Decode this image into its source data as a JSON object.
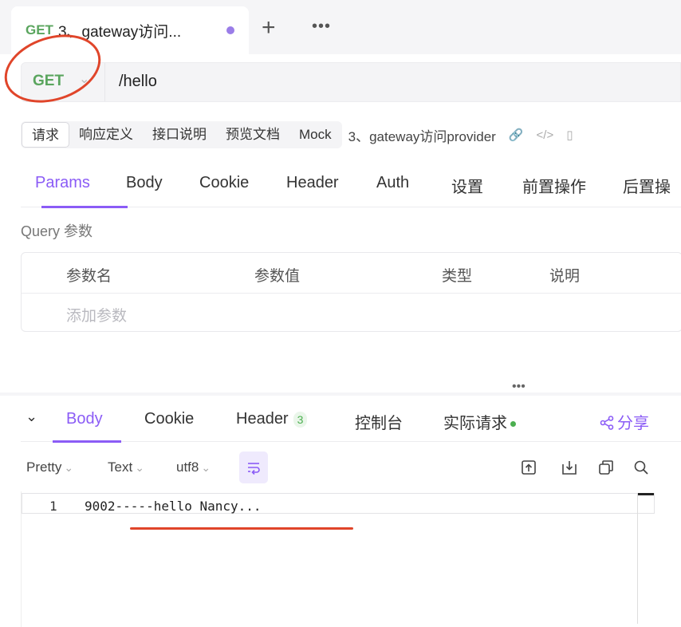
{
  "tab": {
    "method": "GET",
    "title": "3、gateway访问..."
  },
  "request": {
    "method": "GET",
    "url": "/hello"
  },
  "subtabs": [
    "请求",
    "响应定义",
    "接口说明",
    "预览文档",
    "Mock"
  ],
  "request_name": "3、gateway访问provider",
  "param_tabs": [
    "Params",
    "Body",
    "Cookie",
    "Header",
    "Auth",
    "设置",
    "前置操作",
    "后置操"
  ],
  "query": {
    "label": "Query 参数",
    "columns": [
      "参数名",
      "参数值",
      "类型",
      "说明"
    ],
    "placeholder": "添加参数"
  },
  "response_tabs": {
    "body": "Body",
    "cookie": "Cookie",
    "header": "Header",
    "header_count": "3",
    "console": "控制台",
    "actual": "实际请求",
    "share": "分享"
  },
  "toolbar": {
    "format": "Pretty",
    "type": "Text",
    "encoding": "utf8"
  },
  "code": {
    "line_number": "1",
    "content": "9002-----hello Nancy..."
  },
  "colors": {
    "accent": "#8b5cf6",
    "get": "#5aa55e",
    "annotation": "#e0452a"
  }
}
